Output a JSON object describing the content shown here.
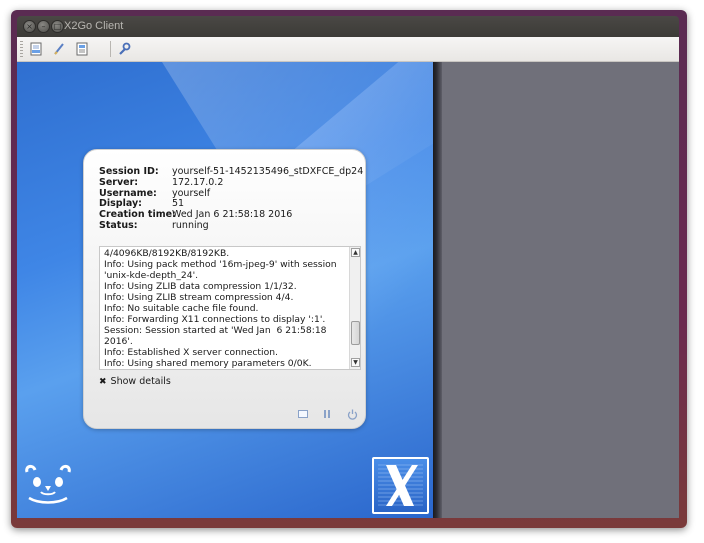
{
  "window": {
    "title": "X2Go Client",
    "buttons": {
      "close": "×",
      "minimize": "–",
      "maximize": "□"
    }
  },
  "toolbar": {
    "icons": [
      "new-session-icon",
      "edit-session-icon",
      "session-list-icon",
      "preferences-icon"
    ]
  },
  "session": {
    "fields": [
      {
        "label": "Session ID:",
        "value": "yourself-51-1452135496_stDXFCE_dp24"
      },
      {
        "label": "Server:",
        "value": "172.17.0.2"
      },
      {
        "label": "Username:",
        "value": "yourself"
      },
      {
        "label": "Display:",
        "value": "51"
      },
      {
        "label": "Creation time:",
        "value": "Wed Jan 6 21:58:18 2016"
      },
      {
        "label": "Status:",
        "value": "running"
      }
    ],
    "log": [
      "4/4096KB/8192KB/8192KB.",
      "Info: Using pack method '16m-jpeg-9' with session 'unix-kde-depth_24'.",
      "Info: Using ZLIB data compression 1/1/32.",
      "Info: Using ZLIB stream compression 4/4.",
      "Info: No suitable cache file found.",
      "Info: Forwarding X11 connections to display ':1'.",
      "Session: Session started at 'Wed Jan  6 21:58:18 2016'.",
      "Info: Established X server connection.",
      "Info: Using shared memory parameters 0/0K."
    ],
    "show_details": "Show details",
    "show_details_icon": "✖",
    "action_icons": [
      "hide-window-icon",
      "suspend-icon",
      "terminate-icon"
    ]
  },
  "colors": {
    "accent_blue": "#2f6fd0",
    "panel_gray": "#70707a",
    "titlebar": "#3c3b37"
  }
}
